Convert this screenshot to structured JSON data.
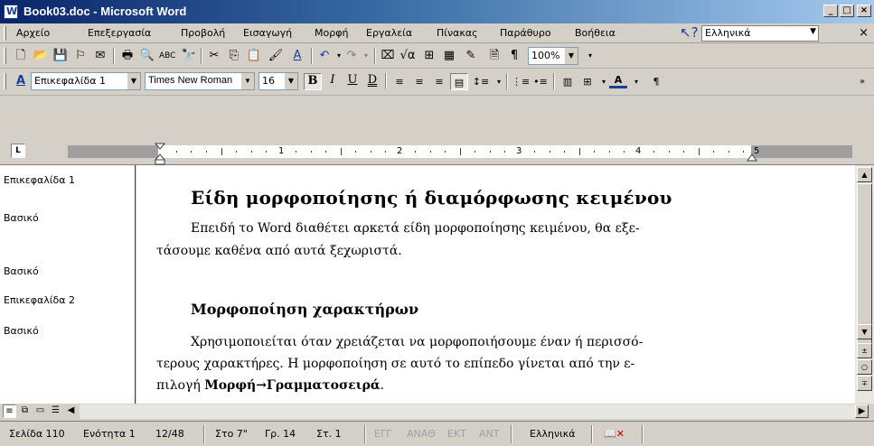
{
  "window": {
    "title": "Book03.doc - Microsoft Word"
  },
  "menu": {
    "items": [
      "Αρχείο",
      "Επεξεργασία",
      "Προβολή",
      "Εισαγωγή",
      "Μορφή",
      "Εργαλεία",
      "Πίνακας",
      "Παράθυρο",
      "Βοήθεια"
    ],
    "help_box": "Ελληνικά"
  },
  "standard_toolbar": {
    "zoom": "100%"
  },
  "formatting_toolbar": {
    "style": "Επικεφαλίδα 1",
    "font": "Times New Roman",
    "size": "16",
    "bold": "B",
    "italic": "I",
    "underline": "U"
  },
  "ruler": {
    "numbers": [
      "1",
      "2",
      "3",
      "4",
      "5"
    ]
  },
  "style_area": [
    "Επικεφαλίδα 1",
    "Βασικό",
    "Βασικό",
    "Επικεφαλίδα 2",
    "Βασικό"
  ],
  "document": {
    "heading1": "Είδη μορφοποίησης ή διαμόρφωσης κειμένου",
    "para1_line1": "Επειδή το Word διαθέτει αρκετά είδη μορφοποίησης κειμένου, θα εξε-",
    "para1_line2": "τάσουμε καθένα από αυτά ξεχωριστά.",
    "heading2": "Μορφοποίηση χαρακτήρων",
    "para2_line1": "Χρησιμοποιείται όταν χρειάζεται να μορφοποιήσουμε έναν ή περισσό-",
    "para2_line2": "τερους χαρακτήρες. Η μορφοποίηση σε αυτό το επίπεδο γίνεται από την ε-",
    "para2_line3_prefix": "πιλογή ",
    "para2_line3_bold": "Μορφή→Γραμματοσειρά",
    "para2_line3_suffix": "."
  },
  "status_bar": {
    "page": "Σελίδα 110",
    "section": "Ενότητα 1",
    "pages": "12/48",
    "at": "Στο 7\"",
    "line": "Γρ. 14",
    "col": "Στ. 1",
    "rec": "ΕΓΓ",
    "trk": "ΑΝΑΘ",
    "ext": "ΕΚΤ",
    "ovr": "ΑΝΤ",
    "language": "Ελληνικά"
  }
}
